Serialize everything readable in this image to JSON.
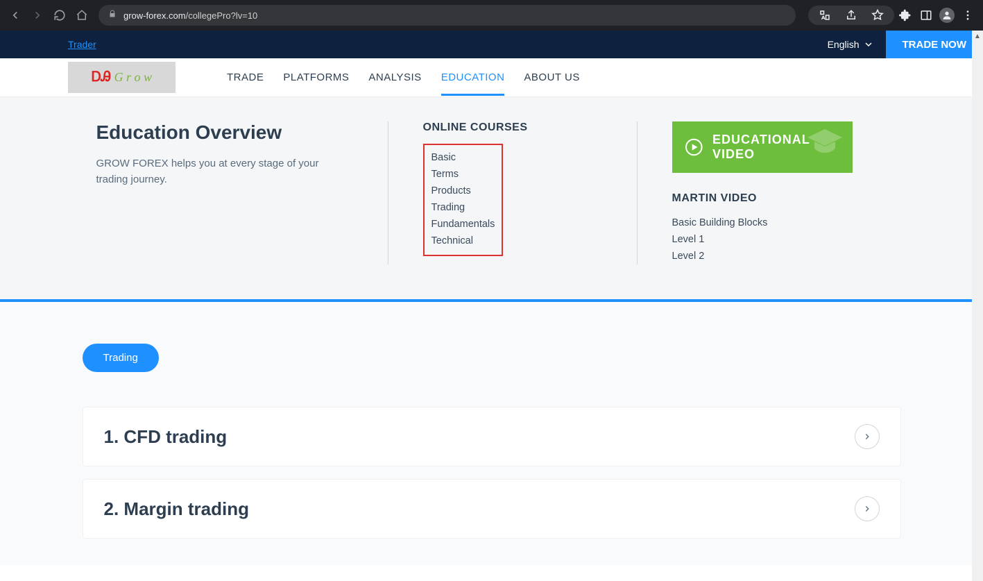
{
  "browser": {
    "url_domain": "grow-forex.com",
    "url_path": "/collegePro?lv=10"
  },
  "topbar": {
    "trader": "Trader",
    "language": "English",
    "trade_now": "TRADE NOW"
  },
  "nav": {
    "items": [
      {
        "label": "TRADE"
      },
      {
        "label": "PLATFORMS"
      },
      {
        "label": "ANALYSIS"
      },
      {
        "label": "EDUCATION"
      },
      {
        "label": "ABOUT US"
      }
    ]
  },
  "mega": {
    "overview_title": "Education Overview",
    "overview_desc": "GROW FOREX helps you at every stage of your trading journey.",
    "courses_title": "ONLINE COURSES",
    "courses": [
      "Basic",
      "Terms",
      "Products",
      "Trading",
      "Fundamentals",
      "Technical"
    ],
    "video_banner": "EDUCATIONAL VIDEO",
    "martin_title": "MARTIN VIDEO",
    "martin_items": [
      "Basic Building Blocks",
      "Level 1",
      "Level 2"
    ]
  },
  "content": {
    "pill": "Trading",
    "accordions": [
      "1. CFD trading",
      "2. Margin trading"
    ]
  }
}
